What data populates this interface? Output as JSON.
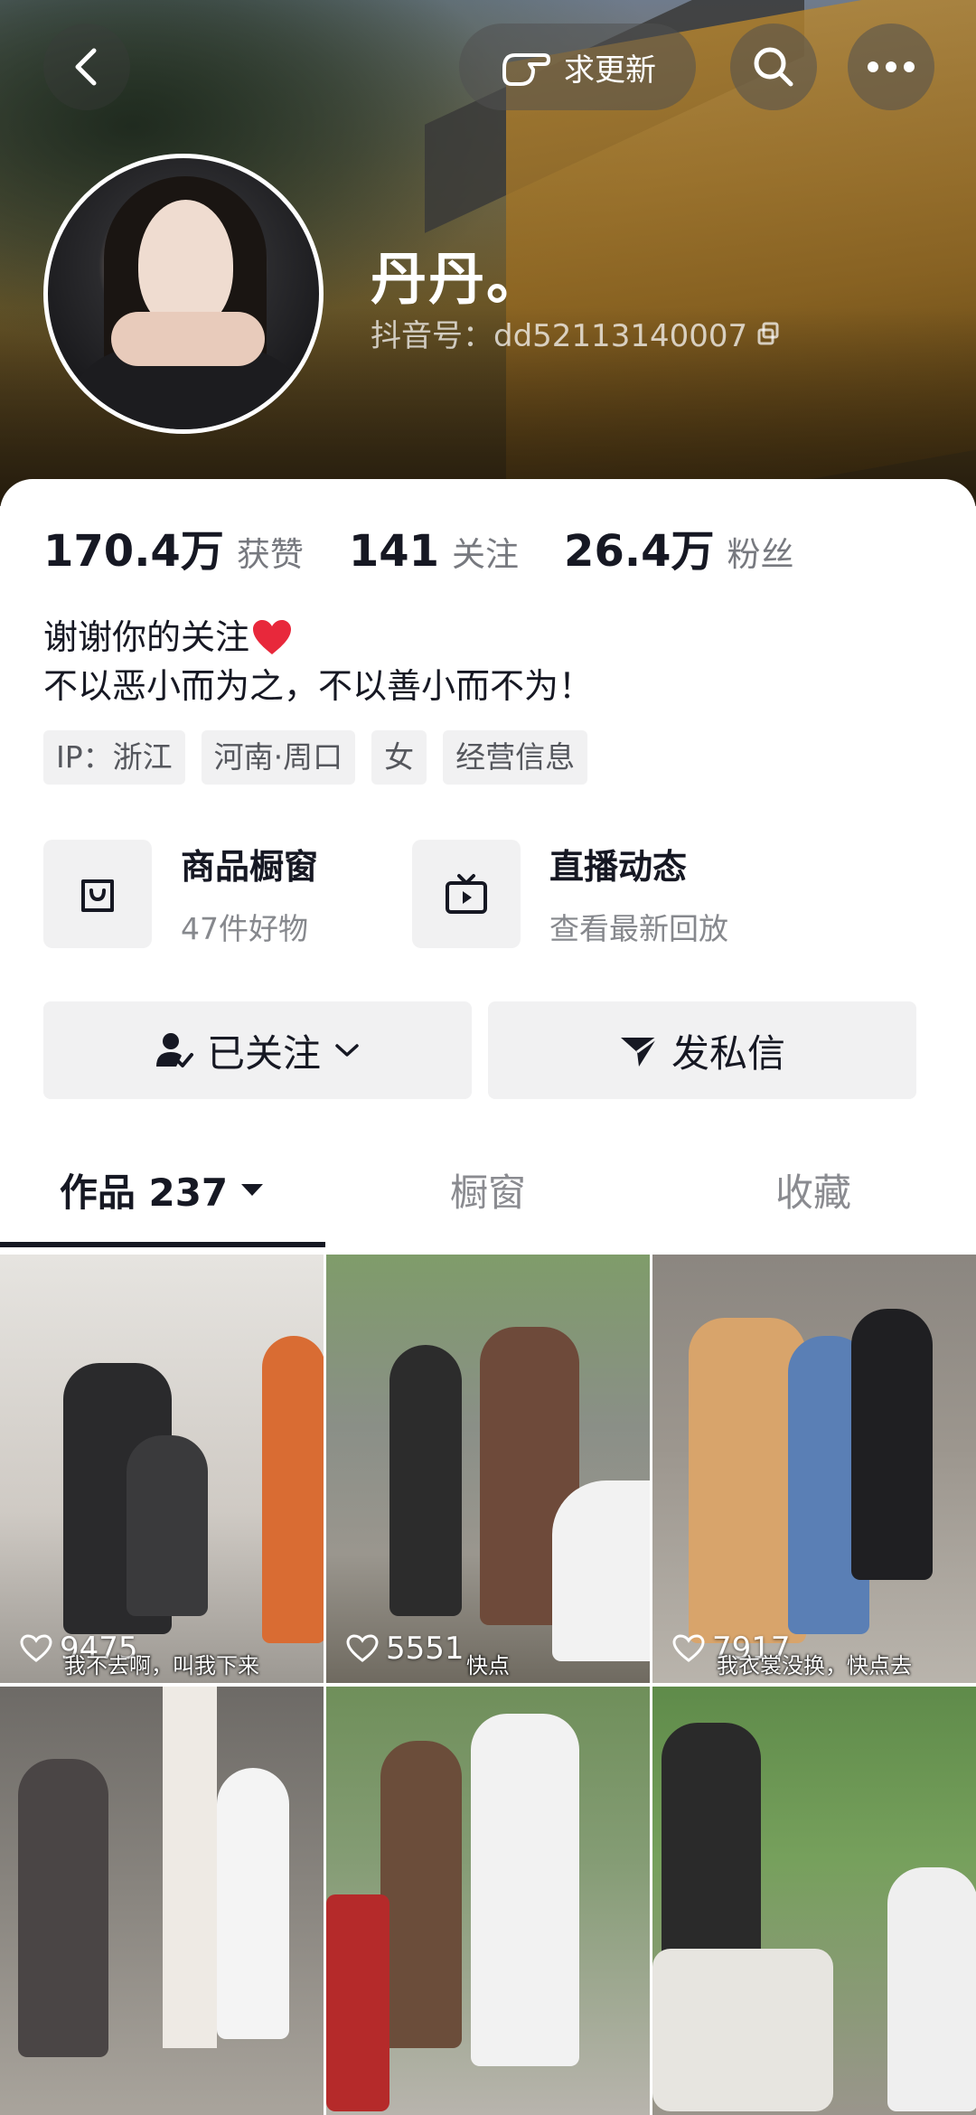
{
  "header": {
    "update_label": "求更新",
    "nickname": "丹丹。",
    "douyin_id": "抖音号：dd52113140007"
  },
  "stats": [
    {
      "value": "170.4万",
      "label": "获赞"
    },
    {
      "value": "141",
      "label": "关注"
    },
    {
      "value": "26.4万",
      "label": "粉丝"
    }
  ],
  "bio": {
    "line1": "谢谢你的关注",
    "line2": "不以恶小而为之，不以善小而不为！"
  },
  "tags": [
    "IP：浙江",
    "河南·周口",
    "女",
    "经营信息"
  ],
  "entries": {
    "shop": {
      "title": "商品橱窗",
      "sub": "47件好物"
    },
    "live": {
      "title": "直播动态",
      "sub": "查看最新回放"
    }
  },
  "actions": {
    "follow_label": "已关注",
    "message_label": "发私信"
  },
  "tabs": {
    "works": "作品 237",
    "shop": "橱窗",
    "favorites": "收藏"
  },
  "videos": [
    {
      "likes": "9475",
      "caption": "我不去啊，叫我下来"
    },
    {
      "likes": "5551",
      "caption": "快点"
    },
    {
      "likes": "7917",
      "caption": "我衣裳没换，快点去"
    },
    {
      "likes": "",
      "caption": ""
    },
    {
      "likes": "",
      "caption": ""
    },
    {
      "likes": "",
      "caption": ""
    }
  ],
  "colors": {
    "accent_text": "#161823",
    "secondary_text": "#77797f",
    "chip_bg": "#f1f1f2",
    "heart": "#e8283b"
  }
}
